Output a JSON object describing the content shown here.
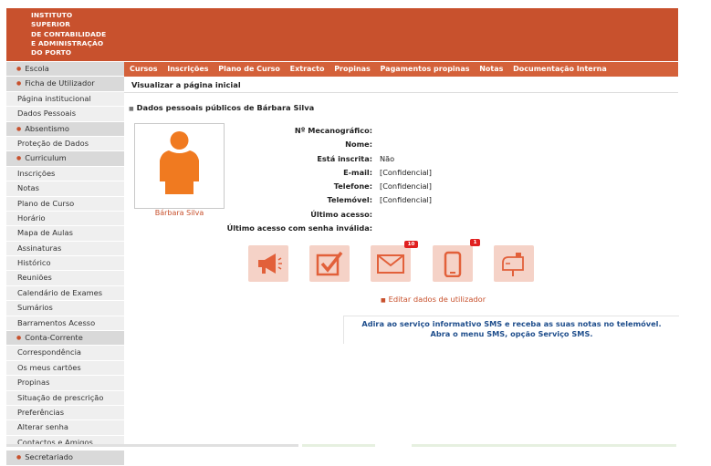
{
  "header": {
    "logo_lines": [
      "INSTITUTO",
      "SUPERIOR",
      "DE CONTABILIDADE",
      "E ADMINISTRAÇÃO",
      "DO PORTO"
    ]
  },
  "sidebar": {
    "items": [
      {
        "label": "Escola",
        "section": true
      },
      {
        "label": "Ficha de Utilizador",
        "section": true
      },
      {
        "label": "Página institucional",
        "section": false
      },
      {
        "label": "Dados Pessoais",
        "section": false
      },
      {
        "label": "Absentismo",
        "section": true
      },
      {
        "label": "Proteção de Dados",
        "section": false
      },
      {
        "label": "Curriculum",
        "section": true
      },
      {
        "label": "Inscrições",
        "section": false
      },
      {
        "label": "Notas",
        "section": false
      },
      {
        "label": "Plano de Curso",
        "section": false
      },
      {
        "label": "Horário",
        "section": false
      },
      {
        "label": "Mapa de Aulas",
        "section": false
      },
      {
        "label": "Assinaturas",
        "section": false
      },
      {
        "label": "Histórico",
        "section": false
      },
      {
        "label": "Reuniões",
        "section": false
      },
      {
        "label": "Calendário de Exames",
        "section": false
      },
      {
        "label": "Sumários",
        "section": false
      },
      {
        "label": "Barramentos Acesso",
        "section": false
      },
      {
        "label": "Conta-Corrente",
        "section": true
      },
      {
        "label": "Correspondência",
        "section": false
      },
      {
        "label": "Os meus cartões",
        "section": false
      },
      {
        "label": "Propinas",
        "section": false
      },
      {
        "label": "Situação de prescrição",
        "section": false
      },
      {
        "label": "Preferências",
        "section": false
      },
      {
        "label": "Alterar senha",
        "section": false
      },
      {
        "label": "Contactos e Amigos",
        "section": false
      },
      {
        "label": "Secretariado",
        "section": true
      }
    ]
  },
  "topnav": [
    "Cursos",
    "Inscrições",
    "Plano de Curso",
    "Extracto",
    "Propinas",
    "Pagamentos propinas",
    "Notas",
    "Documentação Interna"
  ],
  "breadcrumb": "Visualizar a página inicial",
  "profile": {
    "section_title": "Dados pessoais públicos de Bárbara Silva",
    "name": "Bárbara Silva",
    "fields": [
      {
        "label": "Nº Mecanográfico:",
        "value": ""
      },
      {
        "label": "Nome:",
        "value": ""
      },
      {
        "label": "Está inscrita:",
        "value": "Não"
      },
      {
        "label": "E-mail:",
        "value": "[Confidencial]"
      },
      {
        "label": "Telefone:",
        "value": "[Confidencial]"
      },
      {
        "label": "Telemóvel:",
        "value": "[Confidencial]"
      },
      {
        "label": "Último acesso:",
        "value": ""
      },
      {
        "label": "Último acesso com senha inválida:",
        "value": ""
      }
    ]
  },
  "actions": [
    {
      "name": "megaphone-icon",
      "badge": ""
    },
    {
      "name": "checkbox-icon",
      "badge": ""
    },
    {
      "name": "envelope-icon",
      "badge": "10"
    },
    {
      "name": "mobile-phone-icon",
      "badge": "1"
    },
    {
      "name": "mailbox-icon",
      "badge": ""
    }
  ],
  "edit_link": "Editar dados de utilizador",
  "sms": {
    "line1": "Adira ao serviço informativo SMS e receba as suas notas no telemóvel.",
    "line2": "Abra o menu SMS, opção Serviço SMS."
  },
  "colors": {
    "brand": "#c8512d",
    "nav": "#d4613a",
    "icon_bg": "#f5d2c7",
    "avatar": "#f07a20",
    "link_blue": "#1f4e8c"
  }
}
